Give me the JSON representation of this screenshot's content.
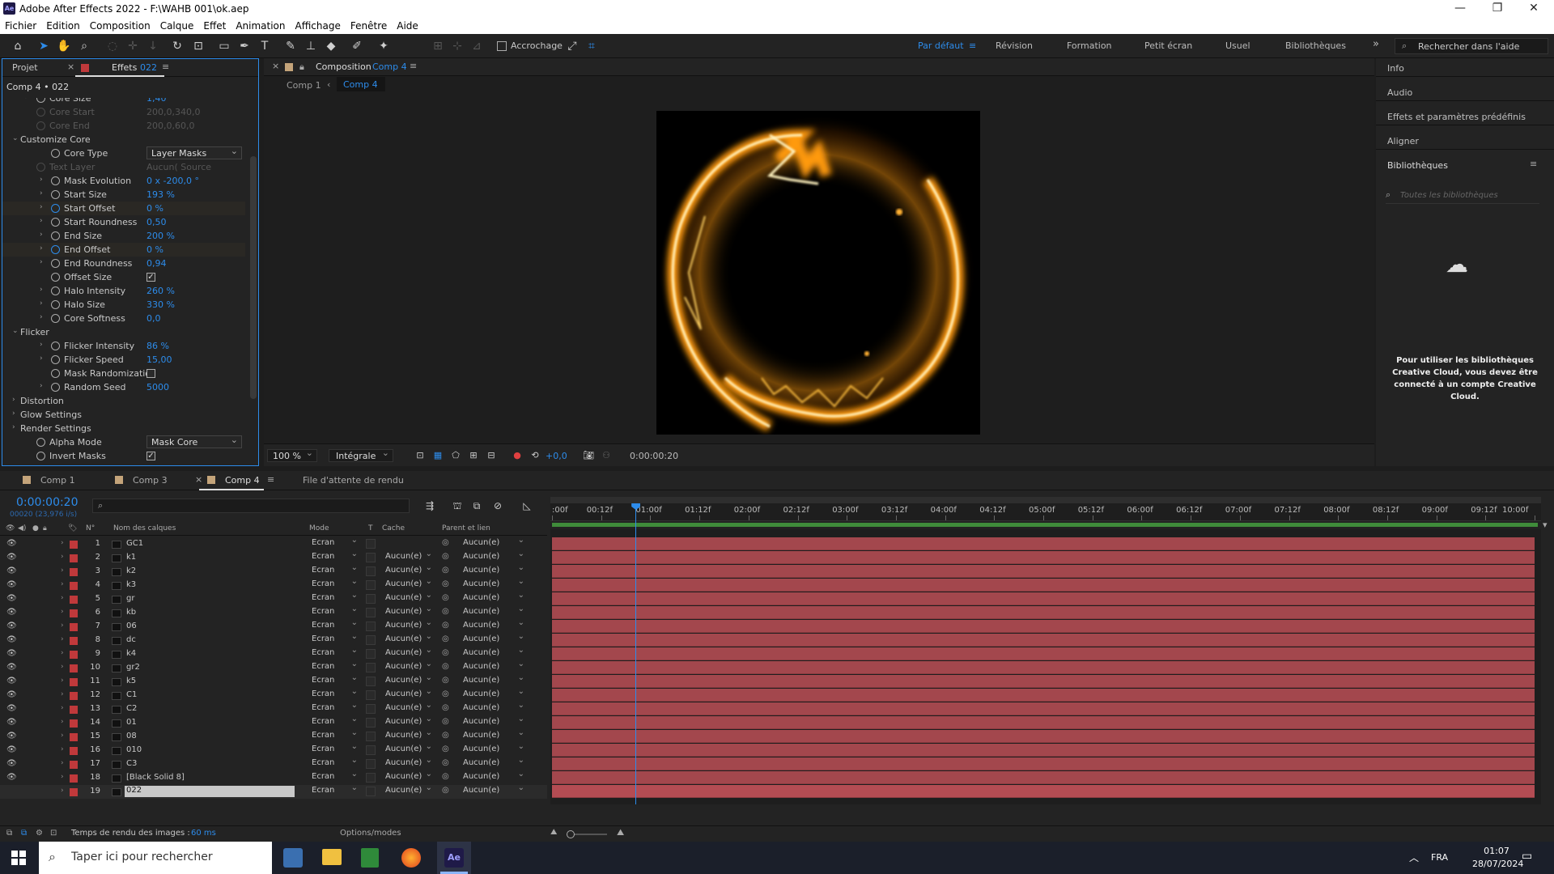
{
  "window": {
    "title": "Adobe After Effects 2022 - F:\\WAHB 001\\ok.aep",
    "logo": "Ae"
  },
  "menu": [
    "Fichier",
    "Edition",
    "Composition",
    "Calque",
    "Effet",
    "Animation",
    "Affichage",
    "Fenêtre",
    "Aide"
  ],
  "toolbar": {
    "snapping": "Accrochage",
    "workspaces": [
      "Par défaut",
      "Révision",
      "Formation",
      "Petit écran",
      "Usuel",
      "Bibliothèques"
    ],
    "help_placeholder": "Rechercher dans l'aide"
  },
  "effects_panel": {
    "tab_project": "Projet",
    "tab_effects": "Effets",
    "tab_effects_layer": "022",
    "header": "Comp 4 • 022",
    "rows": [
      {
        "name": "Core Size",
        "value": "1,40",
        "indent": 2,
        "disabled": false,
        "twirl": true
      },
      {
        "name": "Core Start",
        "value": "200,0,340,0",
        "indent": 2,
        "disabled": true,
        "twirl": false
      },
      {
        "name": "Core End",
        "value": "200,0,60,0",
        "indent": 2,
        "disabled": true,
        "twirl": false
      },
      {
        "name": "Customize Core",
        "value": "",
        "indent": 1,
        "group": true
      },
      {
        "name": "Core Type",
        "value": "Layer Masks",
        "indent": 3,
        "dropdown": true
      },
      {
        "name": "Text Layer",
        "value": "Aucun(  Source",
        "indent": 2,
        "disabled": true,
        "twirl": false
      },
      {
        "name": "Mask Evolution",
        "value": "0 x -200,0 °",
        "indent": 3,
        "twirl": true
      },
      {
        "name": "Start Size",
        "value": "193 %",
        "indent": 3,
        "twirl": true
      },
      {
        "name": "Start Offset",
        "value": "0 %",
        "indent": 3,
        "twirl": true,
        "highlight": true
      },
      {
        "name": "Start Roundness",
        "value": "0,50",
        "indent": 3,
        "twirl": true
      },
      {
        "name": "End Size",
        "value": "200 %",
        "indent": 3,
        "twirl": true
      },
      {
        "name": "End Offset",
        "value": "0 %",
        "indent": 3,
        "twirl": true,
        "highlight": true
      },
      {
        "name": "End Roundness",
        "value": "0,94",
        "indent": 3,
        "twirl": true
      },
      {
        "name": "Offset Size",
        "value": "✓",
        "indent": 3,
        "checkbox": true
      },
      {
        "name": "Halo Intensity",
        "value": "260 %",
        "indent": 3,
        "twirl": true
      },
      {
        "name": "Halo Size",
        "value": "330 %",
        "indent": 3,
        "twirl": true
      },
      {
        "name": "Core Softness",
        "value": "0,0",
        "indent": 3,
        "twirl": true
      },
      {
        "name": "Flicker",
        "value": "",
        "indent": 1,
        "group": true
      },
      {
        "name": "Flicker Intensity",
        "value": "86 %",
        "indent": 3,
        "twirl": true
      },
      {
        "name": "Flicker Speed",
        "value": "15,00",
        "indent": 3,
        "twirl": true
      },
      {
        "name": "Mask Randomizatio",
        "value": "",
        "indent": 3,
        "checkbox": true
      },
      {
        "name": "Random Seed",
        "value": "5000",
        "indent": 3,
        "twirl": true
      },
      {
        "name": "Distortion",
        "value": "",
        "indent": 1,
        "group": true,
        "collapsed": true
      },
      {
        "name": "Glow Settings",
        "value": "",
        "indent": 1,
        "group": true,
        "collapsed": true
      },
      {
        "name": "Render Settings",
        "value": "",
        "indent": 1,
        "group": true,
        "collapsed": true
      },
      {
        "name": "Alpha Mode",
        "value": "Mask Core",
        "indent": 2,
        "dropdown": true
      },
      {
        "name": "Invert Masks",
        "value": "✓",
        "indent": 2,
        "checkbox": true
      }
    ]
  },
  "composition": {
    "tab_label": "Composition",
    "tab_comp": "Comp 4",
    "crumb_1": "Comp 1",
    "crumb_2": "Comp 4",
    "zoom": "100 %",
    "resolution": "Intégrale",
    "exposure": "+0,0",
    "timecode": "0:00:00:20"
  },
  "right_panel": {
    "items": [
      "Info",
      "Audio",
      "Effets et paramètres prédéfinis",
      "Aligner",
      "Bibliothèques"
    ],
    "search_placeholder": "Toutes les bibliothèques",
    "message": "Pour utiliser les bibliothèques Creative Cloud, vous devez être connecté à un compte Creative Cloud."
  },
  "timeline": {
    "tabs": [
      "Comp 1",
      "Comp 3",
      "Comp 4",
      "File d'attente de rendu"
    ],
    "current_time": "0:00:00:20",
    "frame_info": "00020 (23,976 i/s)",
    "columns": {
      "num": "N°",
      "name": "Nom des calques",
      "mode": "Mode",
      "t": "T",
      "matte": "Cache",
      "parent": "Parent et lien"
    },
    "ruler": [
      ":00f",
      "00:12f",
      "01:00f",
      "01:12f",
      "02:00f",
      "02:12f",
      "03:00f",
      "03:12f",
      "04:00f",
      "04:12f",
      "05:00f",
      "05:12f",
      "06:00f",
      "06:12f",
      "07:00f",
      "07:12f",
      "08:00f",
      "08:12f",
      "09:00f",
      "09:12f",
      "10:00f"
    ],
    "playhead_fraction": 0.085,
    "layers": [
      {
        "num": "1",
        "name": "GC1",
        "mode": "Ecran",
        "matte": "",
        "parent": "Aucun(e)"
      },
      {
        "num": "2",
        "name": "k1",
        "mode": "Ecran",
        "matte": "Aucun(e)",
        "parent": "Aucun(e)"
      },
      {
        "num": "3",
        "name": "k2",
        "mode": "Ecran",
        "matte": "Aucun(e)",
        "parent": "Aucun(e)"
      },
      {
        "num": "4",
        "name": "k3",
        "mode": "Ecran",
        "matte": "Aucun(e)",
        "parent": "Aucun(e)"
      },
      {
        "num": "5",
        "name": "gr",
        "mode": "Ecran",
        "matte": "Aucun(e)",
        "parent": "Aucun(e)"
      },
      {
        "num": "6",
        "name": "kb",
        "mode": "Ecran",
        "matte": "Aucun(e)",
        "parent": "Aucun(e)"
      },
      {
        "num": "7",
        "name": "06",
        "mode": "Ecran",
        "matte": "Aucun(e)",
        "parent": "Aucun(e)"
      },
      {
        "num": "8",
        "name": "dc",
        "mode": "Ecran",
        "matte": "Aucun(e)",
        "parent": "Aucun(e)"
      },
      {
        "num": "9",
        "name": "k4",
        "mode": "Ecran",
        "matte": "Aucun(e)",
        "parent": "Aucun(e)"
      },
      {
        "num": "10",
        "name": "gr2",
        "mode": "Ecran",
        "matte": "Aucun(e)",
        "parent": "Aucun(e)"
      },
      {
        "num": "11",
        "name": "k5",
        "mode": "Ecran",
        "matte": "Aucun(e)",
        "parent": "Aucun(e)"
      },
      {
        "num": "12",
        "name": "C1",
        "mode": "Ecran",
        "matte": "Aucun(e)",
        "parent": "Aucun(e)"
      },
      {
        "num": "13",
        "name": "C2",
        "mode": "Ecran",
        "matte": "Aucun(e)",
        "parent": "Aucun(e)"
      },
      {
        "num": "14",
        "name": "01",
        "mode": "Ecran",
        "matte": "Aucun(e)",
        "parent": "Aucun(e)"
      },
      {
        "num": "15",
        "name": "08",
        "mode": "Ecran",
        "matte": "Aucun(e)",
        "parent": "Aucun(e)"
      },
      {
        "num": "16",
        "name": "010",
        "mode": "Ecran",
        "matte": "Aucun(e)",
        "parent": "Aucun(e)"
      },
      {
        "num": "17",
        "name": "C3",
        "mode": "Ecran",
        "matte": "Aucun(e)",
        "parent": "Aucun(e)"
      },
      {
        "num": "18",
        "name": "[Black Solid 8]",
        "mode": "Ecran",
        "matte": "Aucun(e)",
        "parent": "Aucun(e)"
      },
      {
        "num": "19",
        "name": "022",
        "mode": "Ecran",
        "matte": "Aucun(e)",
        "parent": "Aucun(e)",
        "selected": true
      }
    ],
    "render_time_label": "Temps de rendu des images :",
    "render_time_value": "60 ms",
    "toggle_label": "Options/modes"
  },
  "taskbar": {
    "search_placeholder": "Taper ici pour rechercher",
    "lang": "FRA",
    "time": "01:07",
    "date": "28/07/2024"
  },
  "colors": {
    "accent": "#2d8ceb",
    "layer_bar": "#a3474d",
    "layer_label": "#c0393b",
    "work_area": "#3f8c3a"
  }
}
